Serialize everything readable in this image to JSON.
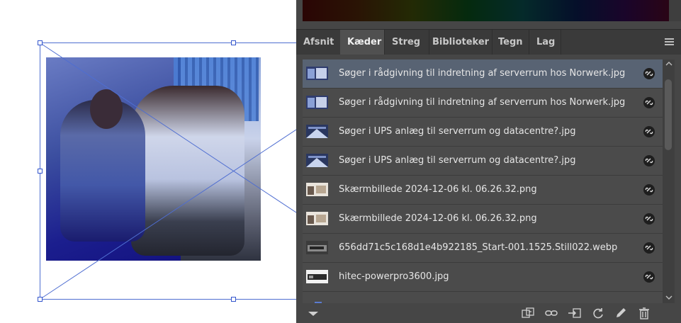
{
  "panel": {
    "tabs": [
      {
        "label": "Afsnit",
        "active": false
      },
      {
        "label": "Kæder",
        "active": true
      },
      {
        "label": "Streg",
        "active": false
      },
      {
        "label": "Biblioteker",
        "active": false
      },
      {
        "label": "Tegn",
        "active": false
      },
      {
        "label": "Lag",
        "active": false
      }
    ],
    "menu_icon": "hamburger-icon",
    "links": [
      {
        "name": "Søger i rådgivning til indretning af serverrum hos Norwerk.jpg",
        "selected": true,
        "status_icon": "link-icon"
      },
      {
        "name": "Søger i rådgivning til indretning af serverrum hos Norwerk.jpg",
        "selected": false,
        "status_icon": "link-icon"
      },
      {
        "name": "Søger i UPS anlæg til serverrum og datacentre?.jpg",
        "selected": false,
        "status_icon": "link-icon"
      },
      {
        "name": "Søger i UPS anlæg til serverrum og datacentre?.jpg",
        "selected": false,
        "status_icon": "link-icon"
      },
      {
        "name": "Skærmbillede 2024-12-06 kl. 06.26.32.png",
        "selected": false,
        "status_icon": "link-icon"
      },
      {
        "name": "Skærmbillede 2024-12-06 kl. 06.26.32.png",
        "selected": false,
        "status_icon": "link-icon"
      },
      {
        "name": "656dd71c5c168d1e4b922185_Start-001.1525.Still022.webp",
        "selected": false,
        "status_icon": "link-icon"
      },
      {
        "name": "hitec-powerpro3600.jpg",
        "selected": false,
        "status_icon": "link-icon"
      }
    ],
    "footer_icons": [
      "expand-triangle-icon",
      "relink-from-cc-icon",
      "relink-icon",
      "go-to-link-icon",
      "update-link-icon",
      "edit-original-icon",
      "delete-icon"
    ]
  },
  "colors": {
    "panel_bg": "#464646",
    "tab_bar_bg": "#3a3a3a",
    "active_tab_bg": "#505050",
    "selected_row_bg": "#586373",
    "row_bg": "#4b4b4b",
    "frame_blue": "#4f6ed1"
  }
}
